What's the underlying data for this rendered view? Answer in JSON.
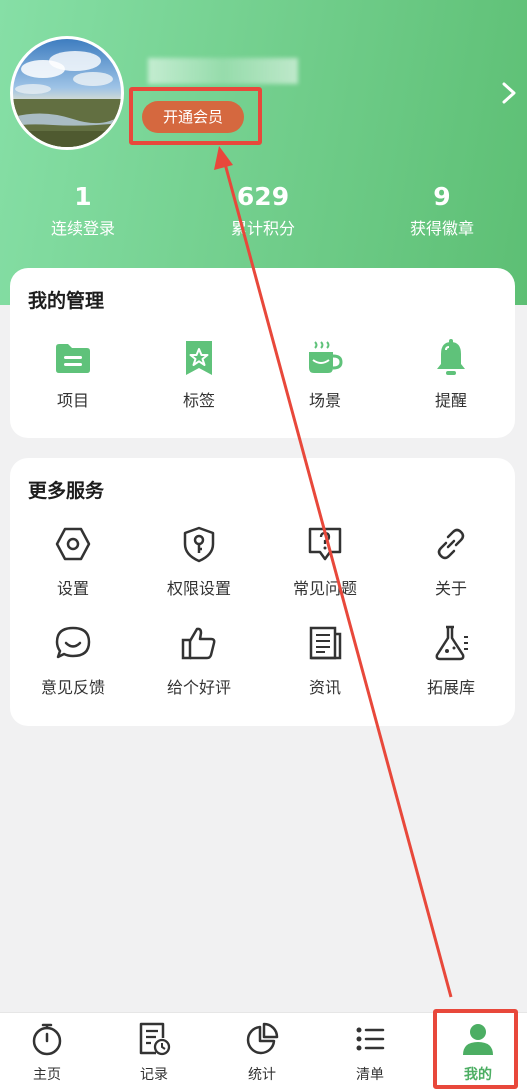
{
  "profile": {
    "member_button": "开通会员",
    "chevron_icon": "chevron-right-icon"
  },
  "stats": [
    {
      "value": "1",
      "label": "连续登录"
    },
    {
      "value": "629",
      "label": "累计积分"
    },
    {
      "value": "9",
      "label": "获得徽章"
    }
  ],
  "management": {
    "title": "我的管理",
    "items": [
      {
        "label": "项目",
        "icon": "folder-icon"
      },
      {
        "label": "标签",
        "icon": "bookmark-star-icon"
      },
      {
        "label": "场景",
        "icon": "coffee-cup-icon"
      },
      {
        "label": "提醒",
        "icon": "bell-icon"
      }
    ]
  },
  "services": {
    "title": "更多服务",
    "items": [
      {
        "label": "设置",
        "icon": "hexagon-settings-icon"
      },
      {
        "label": "权限设置",
        "icon": "shield-key-icon"
      },
      {
        "label": "常见问题",
        "icon": "question-bubble-icon"
      },
      {
        "label": "关于",
        "icon": "link-icon"
      },
      {
        "label": "意见反馈",
        "icon": "smile-chat-icon"
      },
      {
        "label": "给个好评",
        "icon": "thumbs-up-icon"
      },
      {
        "label": "资讯",
        "icon": "newspaper-icon"
      },
      {
        "label": "拓展库",
        "icon": "flask-icon"
      }
    ]
  },
  "tabbar": [
    {
      "label": "主页",
      "icon": "stopwatch-icon"
    },
    {
      "label": "记录",
      "icon": "record-clock-icon"
    },
    {
      "label": "统计",
      "icon": "pie-chart-icon"
    },
    {
      "label": "清单",
      "icon": "list-icon"
    },
    {
      "label": "我的",
      "icon": "person-icon",
      "active": true
    }
  ],
  "colors": {
    "accent_green": "#5dbf74",
    "member_orange": "#d5683f",
    "annotation_red": "#e8483b"
  }
}
